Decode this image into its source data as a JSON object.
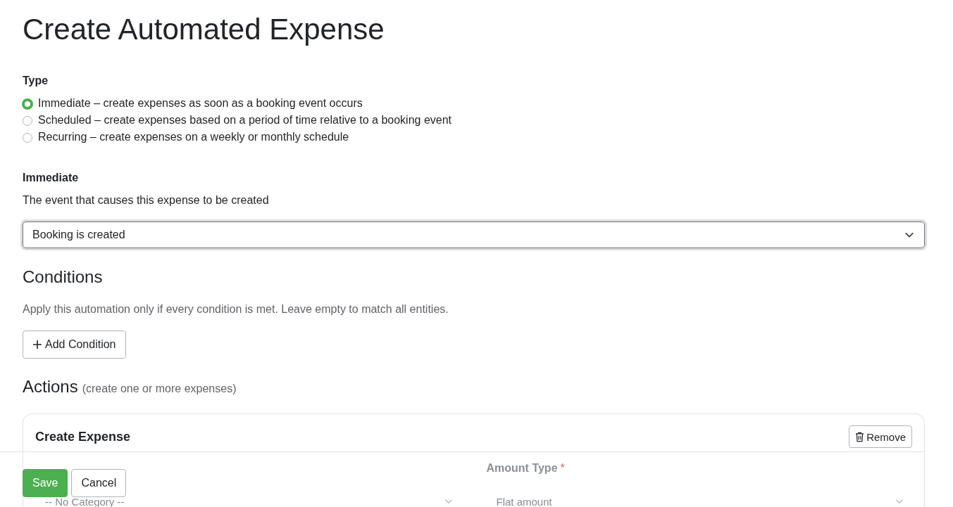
{
  "title": "Create Automated Expense",
  "type_section": {
    "label": "Type",
    "options": [
      {
        "label": "Immediate – create expenses as soon as a booking event occurs",
        "selected": true
      },
      {
        "label": "Scheduled – create expenses based on a period of time relative to a booking event",
        "selected": false
      },
      {
        "label": "Recurring – create expenses on a weekly or monthly schedule",
        "selected": false
      }
    ]
  },
  "immediate": {
    "heading": "Immediate",
    "description": "The event that causes this expense to be created",
    "event_select": {
      "value": "Booking is created"
    }
  },
  "conditions": {
    "heading": "Conditions",
    "description": "Apply this automation only if every condition is met. Leave empty to match all entities.",
    "add_button": "Add Condition"
  },
  "actions": {
    "heading": "Actions",
    "note": "(create one or more expenses)",
    "cards": [
      {
        "title": "Create Expense",
        "remove_button": "Remove",
        "fields": [
          {
            "value": "-- No Category --"
          },
          {
            "label": "Amount Type",
            "required_mark": "*",
            "value": "Flat amount"
          }
        ]
      }
    ]
  },
  "footer": {
    "buttons": [
      {
        "label": "Save",
        "kind": "primary"
      },
      {
        "label": "Cancel",
        "kind": "secondary"
      }
    ]
  }
}
